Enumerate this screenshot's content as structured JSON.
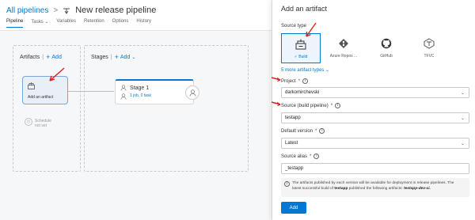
{
  "breadcrumb": {
    "parent": "All pipelines",
    "separator": ">",
    "title": "New release pipeline"
  },
  "tabs": [
    {
      "label": "Pipeline"
    },
    {
      "label": "Tasks"
    },
    {
      "label": "Variables"
    },
    {
      "label": "Retention"
    },
    {
      "label": "Options"
    },
    {
      "label": "History"
    }
  ],
  "artifacts": {
    "heading": "Artifacts",
    "add_label": "Add",
    "card_label": "Add an artifact",
    "schedule_line1": "Schedule",
    "schedule_line2": "not set"
  },
  "stages": {
    "heading": "Stages",
    "add_label": "Add",
    "stage_name": "Stage 1",
    "stage_sub": "1 job, 0 task"
  },
  "panel": {
    "title": "Add an artifact",
    "source_type_label": "Source type",
    "sources": [
      {
        "name": "Build",
        "icon": "build-icon",
        "selected": true
      },
      {
        "name": "Azure Repos ...",
        "icon": "azure-repos-icon",
        "selected": false
      },
      {
        "name": "GitHub",
        "icon": "github-icon",
        "selected": false
      },
      {
        "name": "TFVC",
        "icon": "tfvc-icon",
        "selected": false
      }
    ],
    "more_types": "5 more artifact types",
    "project_label": "Project",
    "project_value": "darkomirchevski",
    "source_label": "Source (build pipeline)",
    "source_value": "testapp",
    "default_version_label": "Default version",
    "default_version_value": "Latest",
    "alias_label": "Source alias",
    "alias_value": "_testapp",
    "note_line1": "The artifacts published by each version will be available for deployment in release pipelines. The",
    "note_line2_a": "latest successful build of",
    "note_line2_b": "testapp",
    "note_line2_c": "published the following artifacts:",
    "note_line2_d": "testapp-dev-ci.",
    "add_button": "Add"
  },
  "colors": {
    "accent": "#0078d4",
    "annotation_arrow": "#e02020"
  }
}
